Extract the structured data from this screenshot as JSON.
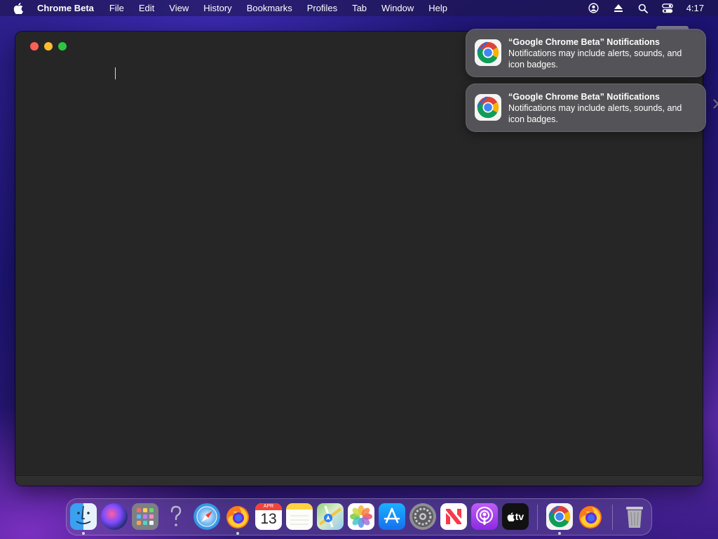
{
  "menubar": {
    "app_name": "Chrome Beta",
    "items": [
      "File",
      "Edit",
      "View",
      "History",
      "Bookmarks",
      "Profiles",
      "Tab",
      "Window",
      "Help"
    ],
    "status_icons": [
      "user-account-icon",
      "eject-icon",
      "spotlight-search-icon",
      "control-center-icon"
    ],
    "clock": "4:17"
  },
  "window": {
    "background": "#262626",
    "traffic_lights": {
      "close": "#ff5f57",
      "minimize": "#febc2e",
      "zoom": "#28c840"
    }
  },
  "notifications": [
    {
      "title": "“Google Chrome Beta” Notifications",
      "body": "Notifications may include alerts, sounds, and icon badges.",
      "icon": "chrome-beta-icon"
    },
    {
      "title": "“Google Chrome Beta” Notifications",
      "body": "Notifications may include alerts, sounds, and icon badges.",
      "icon": "chrome-beta-icon"
    }
  ],
  "dock": {
    "apps": [
      {
        "name": "finder-icon",
        "running": true
      },
      {
        "name": "siri-icon",
        "running": false
      },
      {
        "name": "launchpad-icon",
        "running": false
      },
      {
        "name": "unknown-app-icon",
        "running": false
      },
      {
        "name": "safari-icon",
        "running": false
      },
      {
        "name": "firefox-icon",
        "running": true
      },
      {
        "name": "calendar-icon",
        "running": false,
        "month": "APR",
        "day": "13"
      },
      {
        "name": "notes-icon",
        "running": false
      },
      {
        "name": "maps-icon",
        "running": false
      },
      {
        "name": "photos-icon",
        "running": false
      },
      {
        "name": "app-store-icon",
        "running": false
      },
      {
        "name": "system-preferences-icon",
        "running": false
      },
      {
        "name": "news-icon",
        "running": false
      },
      {
        "name": "podcasts-icon",
        "running": false
      },
      {
        "name": "apple-tv-icon",
        "running": false,
        "label": "tv"
      },
      {
        "name": "chrome-beta-icon",
        "running": true
      },
      {
        "name": "firefox-icon",
        "running": false
      },
      {
        "name": "trash-icon",
        "running": false
      }
    ]
  }
}
